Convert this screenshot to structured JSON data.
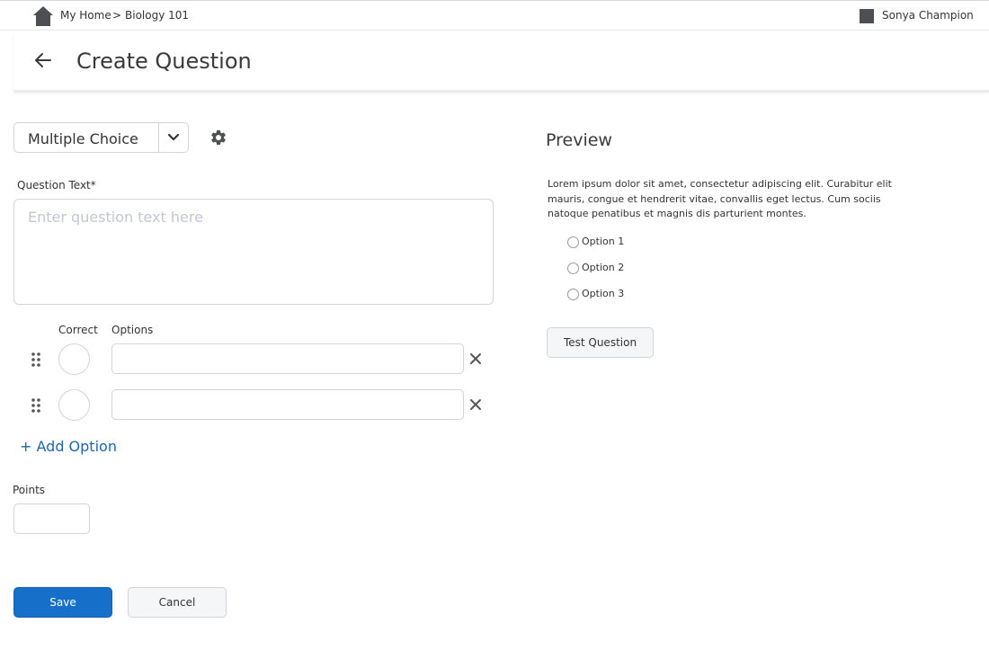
{
  "topbar": {
    "home_icon": "home-icon",
    "breadcrumb": {
      "home": "My Home",
      "separator": ">",
      "course": "Biology 101"
    },
    "user": {
      "name": "Sonya Champion"
    }
  },
  "header": {
    "back_icon": "arrow-left-icon",
    "title": "Create Question"
  },
  "editor": {
    "question_type": "Multiple Choice",
    "settings_icon": "gear-icon",
    "question_text_label": "Question Text*",
    "question_text_placeholder": "Enter question text here",
    "question_text_value": "",
    "columns": {
      "correct": "Correct",
      "options": "Options"
    },
    "options": [
      {
        "value": "",
        "correct": false
      },
      {
        "value": "",
        "correct": false
      }
    ],
    "add_option_label": "+ Add Option",
    "points_label": "Points",
    "points_value": ""
  },
  "actions": {
    "save_label": "Save",
    "cancel_label": "Cancel"
  },
  "preview": {
    "title": "Preview",
    "body": "Lorem ipsum dolor sit amet, consectetur adipiscing elit. Curabitur elit mauris, congue et hendrerit vitae, convallis eget lectus. Cum sociis natoque penatibus et magnis dis parturient montes.",
    "options": [
      "Option 1",
      "Option 2",
      "Option 3"
    ],
    "test_label": "Test Question"
  },
  "colors": {
    "primary": "#1670c9",
    "link": "#1e64b4",
    "border": "#d4d4d4",
    "placeholder": "#c2c8d0"
  }
}
